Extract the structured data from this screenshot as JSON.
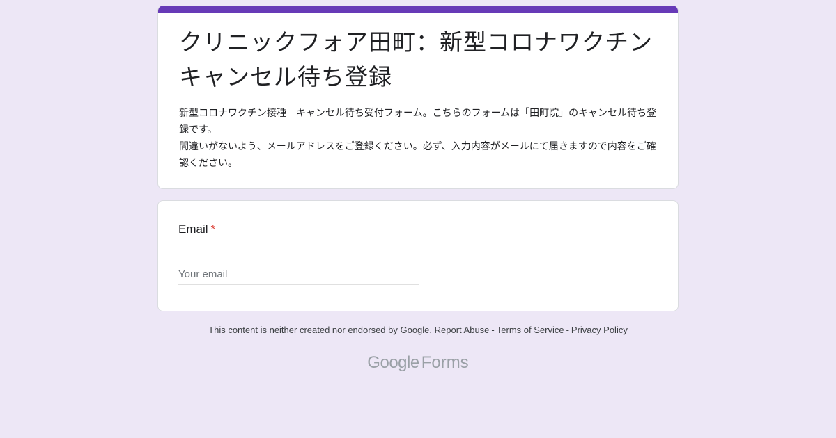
{
  "form": {
    "title": "クリニックフォア田町：新型コロナワクチンキャンセル待ち登録",
    "description": "新型コロナワクチン接種　キャンセル待ち受付フォーム。こちらのフォームは「田町院」のキャンセル待ち登録です。\n間違いがないよう、メールアドレスをご登録ください。必ず、入力内容がメールにて届きますので内容をご確認ください。",
    "accent_color": "#673ab7",
    "background_color": "#ede7f6"
  },
  "question": {
    "label": "Email",
    "required_marker": "*",
    "input_value": "",
    "input_placeholder": "Your email"
  },
  "footer": {
    "disclaimer": "This content is neither created nor endorsed by Google.",
    "report_abuse": "Report Abuse",
    "terms": "Terms of Service",
    "privacy": "Privacy Policy",
    "separator": "-"
  },
  "brand": {
    "google": "Google",
    "forms": "Forms"
  }
}
